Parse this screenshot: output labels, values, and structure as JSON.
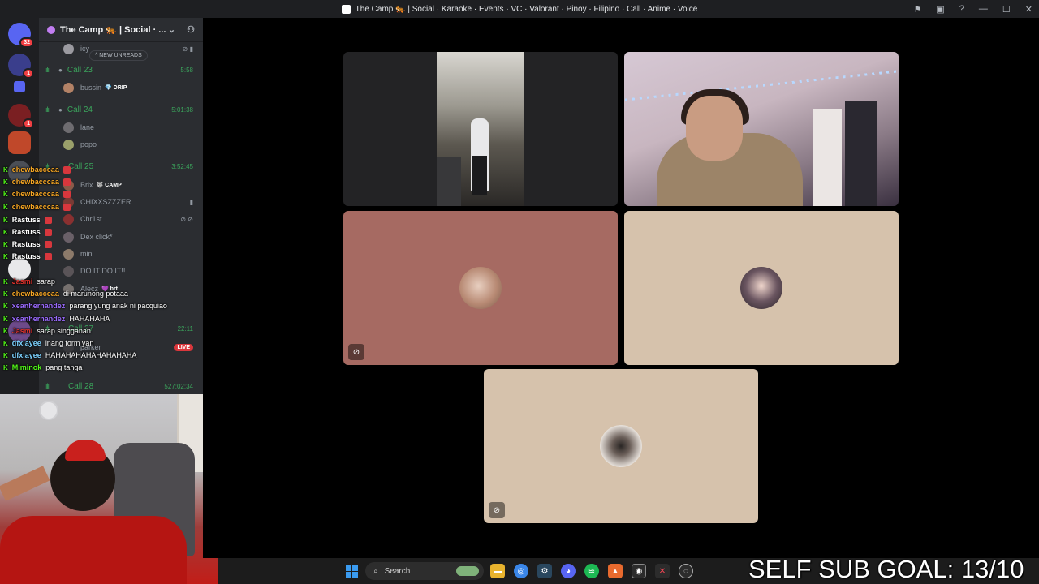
{
  "window": {
    "title": "The Camp 🐅 | Social · Karaoke · Events · VC · Valorant · Pinoy · Filipino · Call · Anime · Voice"
  },
  "server_rail": {
    "badges": [
      "32",
      "1",
      "1"
    ]
  },
  "channel_pane": {
    "server_name": "The Camp 🐅 | Social · ...",
    "new_unreads": "^ NEW UNREADS",
    "voice_channels": [
      {
        "name": "Call 23",
        "time": "5:58"
      },
      {
        "name": "Call 24",
        "time": "5:01:38"
      },
      {
        "name": "Call 25",
        "time": "3:52:45"
      },
      {
        "name": "Call 27",
        "time": "22:11"
      },
      {
        "name": "Call 28",
        "time": "527:02:34"
      }
    ],
    "members": [
      {
        "name": "icy",
        "tag": ""
      },
      {
        "name": "bussin",
        "tag": "💎 DRIP"
      },
      {
        "name": "lane",
        "tag": ""
      },
      {
        "name": "popo",
        "tag": ""
      },
      {
        "name": "Brix",
        "tag": "🐺 CAMP"
      },
      {
        "name": "CHIXXSZZZER",
        "tag": ""
      },
      {
        "name": "Chr1st",
        "tag": ""
      },
      {
        "name": "Dex click*",
        "tag": ""
      },
      {
        "name": "min",
        "tag": ""
      },
      {
        "name": "DO IT DO IT!!",
        "tag": ""
      },
      {
        "name": "Alecz",
        "tag": "💜 brt"
      },
      {
        "name": "parker",
        "tag": "",
        "live": "LIVE"
      }
    ]
  },
  "chat": {
    "lines": [
      {
        "user": "chewbacccaa",
        "color": "#f6a623",
        "msg": ""
      },
      {
        "user": "chewbacccaa",
        "color": "#f6a623",
        "msg": ""
      },
      {
        "user": "chewbacccaa",
        "color": "#f6a623",
        "msg": ""
      },
      {
        "user": "chewbacccaa",
        "color": "#f6a623",
        "msg": ""
      },
      {
        "user": "Rastuss",
        "color": "#ffffff",
        "msg": ""
      },
      {
        "user": "Rastuss",
        "color": "#ffffff",
        "msg": ""
      },
      {
        "user": "Rastuss",
        "color": "#ffffff",
        "msg": ""
      },
      {
        "user": "Rastuss",
        "color": "#ffffff",
        "msg": ""
      },
      {
        "user": "Jasmi",
        "color": "#e0312b",
        "msg": "sarap"
      },
      {
        "user": "chewbacccaa",
        "color": "#f6a623",
        "msg": "di marunong potaaa"
      },
      {
        "user": "xeanhernandez",
        "color": "#9b6bff",
        "msg": "parang yung anak ni pacquiao"
      },
      {
        "user": "xeanhernandez",
        "color": "#9b6bff",
        "msg": "HAHAHAHA"
      },
      {
        "user": "Jasmi",
        "color": "#e0312b",
        "msg": "sarap singganan"
      },
      {
        "user": "dfxlayee",
        "color": "#7cd2ff",
        "msg": "inang form yan"
      },
      {
        "user": "dfxlayee",
        "color": "#7cd2ff",
        "msg": "HAHAHAHAHAHAHAHAHA"
      },
      {
        "user": "Miminok",
        "color": "#53fc18",
        "msg": "pang tanga"
      }
    ]
  },
  "taskbar": {
    "search_placeholder": "Search"
  },
  "overlay": {
    "sub_goal": "SELF SUB GOAL: 13/10"
  },
  "colors": {
    "discord_bg": "#2b2d31",
    "voice_green": "#3ba55c",
    "tile_rose": "#a66a62",
    "tile_beige": "#d6c2ac"
  }
}
